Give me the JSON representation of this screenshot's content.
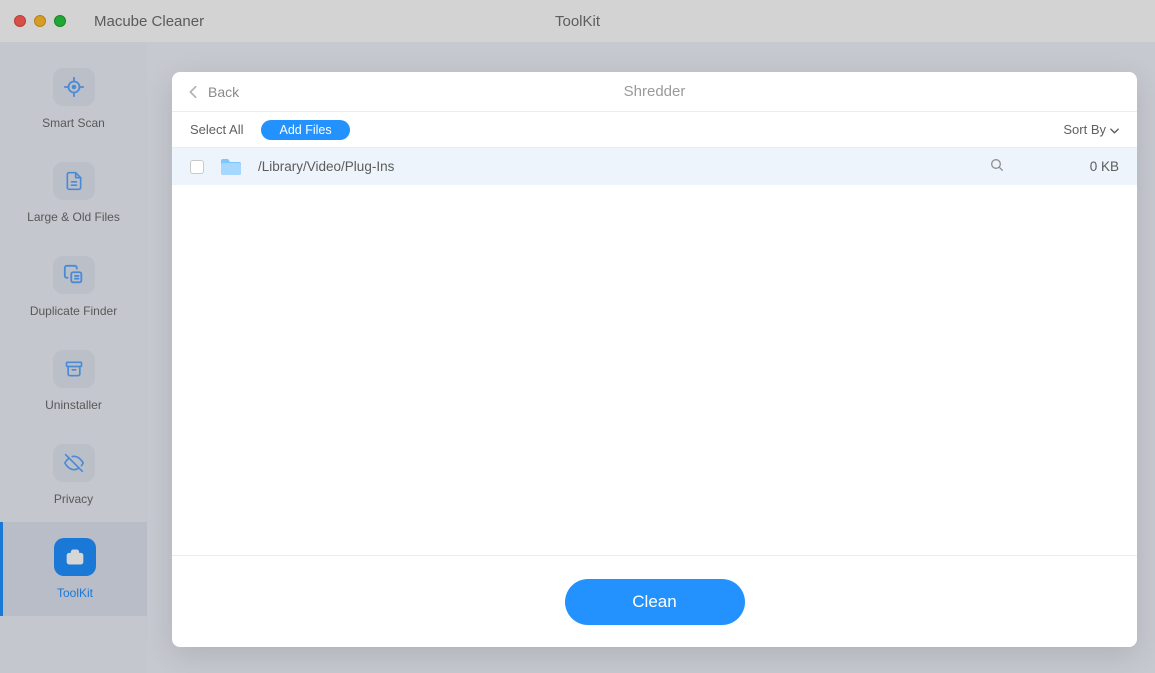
{
  "titlebar": {
    "app_name": "Macube Cleaner",
    "section": "ToolKit"
  },
  "sidebar": {
    "items": [
      {
        "label": "Smart Scan"
      },
      {
        "label": "Large & Old Files"
      },
      {
        "label": "Duplicate Finder"
      },
      {
        "label": "Uninstaller"
      },
      {
        "label": "Privacy"
      },
      {
        "label": "ToolKit"
      }
    ],
    "active_index": 5
  },
  "modal": {
    "back_label": "Back",
    "title": "Shredder",
    "toolbar": {
      "select_all": "Select All",
      "add_files": "Add Files",
      "sort_by": "Sort By"
    },
    "files": [
      {
        "path": "/Library/Video/Plug-Ins",
        "size": "0 KB",
        "checked": false
      }
    ],
    "clean_label": "Clean"
  },
  "colors": {
    "accent": "#2392ff"
  }
}
